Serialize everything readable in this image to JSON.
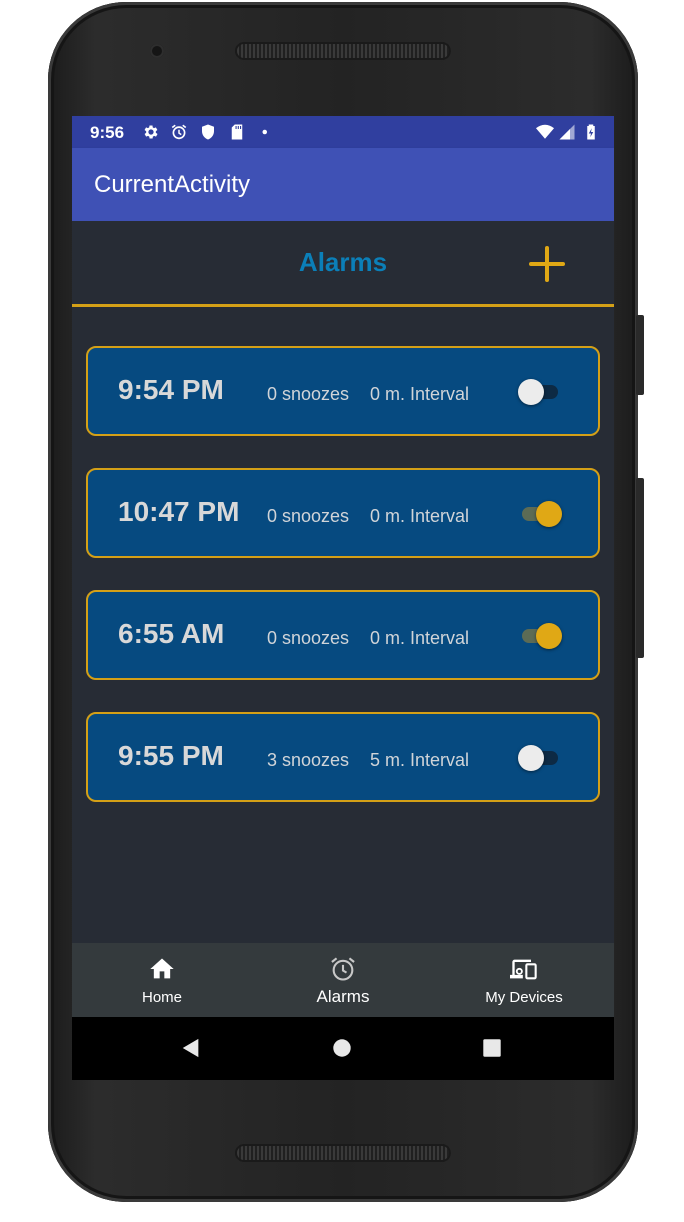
{
  "status_bar": {
    "time": "9:56",
    "icons": [
      "gear-icon",
      "alarm-clock-icon",
      "shield-icon",
      "sd-card-icon",
      "dot-icon",
      "wifi-icon",
      "signal-icon",
      "battery-charging-icon"
    ]
  },
  "app_bar": {
    "title": "CurrentActivity"
  },
  "header": {
    "title": "Alarms",
    "add_icon": "plus-icon"
  },
  "colors": {
    "accent": "#d4a017",
    "title_blue": "#0b7fb8",
    "card_bg": "#064a80",
    "app_bar": "#3f51b5",
    "status_bar": "#303f9f",
    "background": "#272c35"
  },
  "alarms": [
    {
      "time": "9:54 PM",
      "snoozes": "0 snoozes",
      "interval": "0 m. Interval",
      "enabled": false
    },
    {
      "time": "10:47 PM",
      "snoozes": "0 snoozes",
      "interval": "0 m. Interval",
      "enabled": true
    },
    {
      "time": "6:55 AM",
      "snoozes": "0 snoozes",
      "interval": "0 m. Interval",
      "enabled": true
    },
    {
      "time": "9:55 PM",
      "snoozes": "3 snoozes",
      "interval": "5 m. Interval",
      "enabled": false
    }
  ],
  "bottom_nav": {
    "items": [
      {
        "label": "Home",
        "icon": "home-icon",
        "active": false
      },
      {
        "label": "Alarms",
        "icon": "alarm-clock-icon",
        "active": true
      },
      {
        "label": "My Devices",
        "icon": "devices-icon",
        "active": false
      }
    ]
  },
  "system_nav": {
    "icons": [
      "back-icon",
      "home-circle-icon",
      "recents-icon"
    ]
  }
}
